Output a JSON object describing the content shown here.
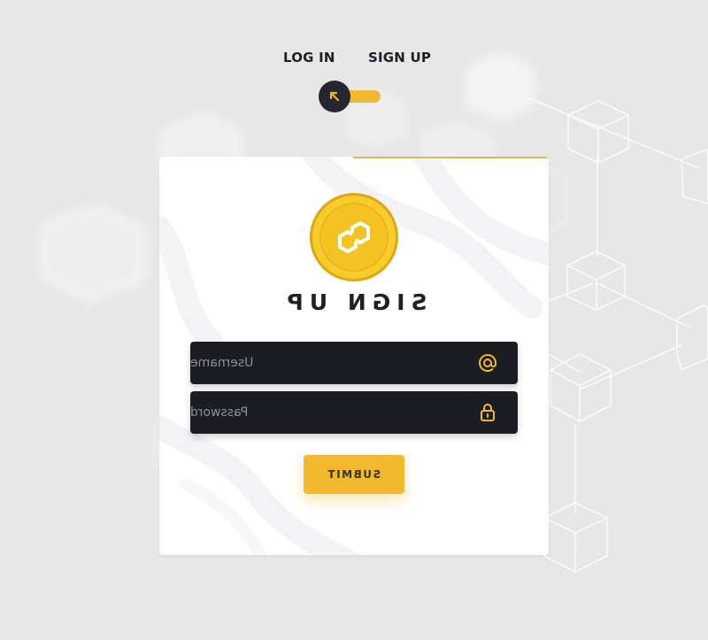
{
  "tabs": {
    "login_label": "LOG IN",
    "signup_label": "SIGN UP"
  },
  "toggle": {
    "icon": "arrow-up-left-icon",
    "state": "signup"
  },
  "card": {
    "logo_icon": "polygon-coin-icon",
    "title": "SIGN UP",
    "username": {
      "icon": "at-sign-icon",
      "placeholder": "Username"
    },
    "password": {
      "icon": "lock-icon",
      "placeholder": "Password"
    },
    "submit_label": "SUBMIT"
  },
  "colors": {
    "accent": "#f2b830",
    "dark": "#1b1d22",
    "background": "#e7e7e7",
    "text": "#1e1f28"
  }
}
